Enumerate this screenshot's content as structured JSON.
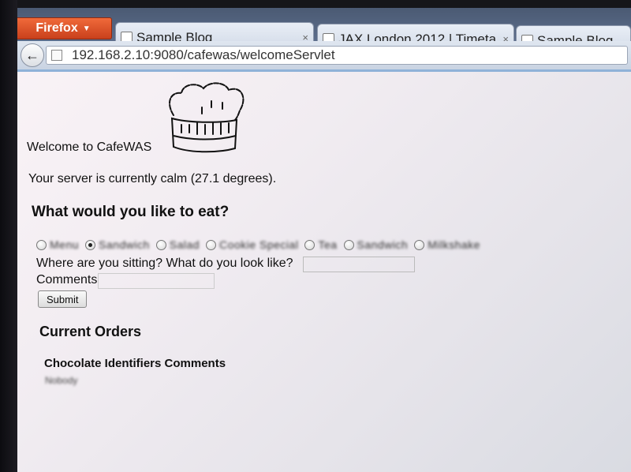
{
  "browser": {
    "menu_button": "Firefox",
    "tabs": [
      {
        "label": "Sample Blog",
        "close": "×"
      },
      {
        "label": "JAX London 2012 | Timeta...",
        "close": "×"
      },
      {
        "label": "Sample Blog"
      }
    ],
    "url": "192.168.2.10:9080/cafewas/welcomeServlet"
  },
  "page": {
    "welcome": "Welcome to CafeWAS",
    "status": "Your server is currently calm (27.1 degrees).",
    "question": "What would you like to eat?",
    "food_options": [
      {
        "label": "Menu",
        "selected": false
      },
      {
        "label": "Sandwich",
        "selected": true
      },
      {
        "label": "Salad",
        "selected": false
      },
      {
        "label": "Cookie Special",
        "selected": false
      },
      {
        "label": "Tea",
        "selected": false
      },
      {
        "label": "Sandwich",
        "selected": false
      },
      {
        "label": "Milkshake",
        "selected": false
      }
    ],
    "sitting_label": "Where are you sitting? What do you look like?",
    "comments_label": "Comments",
    "submit_label": "Submit",
    "orders_title": "Current Orders",
    "orders_header": "Chocolate Identifiers Comments",
    "orders_first_cell": "Nobody"
  }
}
